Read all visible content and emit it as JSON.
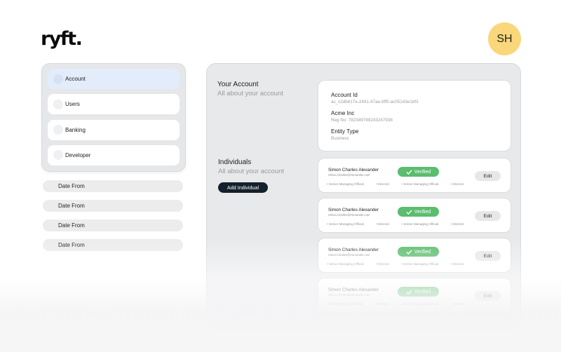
{
  "brand": {
    "logo_text": "ryft."
  },
  "user": {
    "initials": "SH"
  },
  "sidebar": {
    "items": [
      {
        "label": "Account",
        "active": true
      },
      {
        "label": "Users",
        "active": false
      },
      {
        "label": "Banking",
        "active": false
      },
      {
        "label": "Developer",
        "active": false
      }
    ]
  },
  "filters": [
    {
      "label": "Date From"
    },
    {
      "label": "Date From"
    },
    {
      "label": "Date From"
    },
    {
      "label": "Date From"
    }
  ],
  "account": {
    "title": "Your Account",
    "subtitle": "All about your account",
    "id_label": "Account Id",
    "id_value": "ac_c2db817e-2491-47ae-8ff5-ac05143e1bf3",
    "company_name": "Acme Inc",
    "reg_no": "Reg No: 782349789243247938",
    "entity_type_label": "Entity Type",
    "entity_type_value": "Business"
  },
  "individuals": {
    "title": "Individuals",
    "subtitle": "All about your account",
    "add_button": "Add Individual",
    "list": [
      {
        "name": "Simon Charles Alexander",
        "email": "Simon.Charles@Alexander.com",
        "status": "Verified",
        "edit": "Edit",
        "roles": [
          "Senior Managing Official",
          "Director",
          "Senior Managing Official",
          "Director"
        ]
      },
      {
        "name": "Simon Charles Alexander",
        "email": "Simon.Charles@Alexander.com",
        "status": "Verified",
        "edit": "Edit",
        "roles": [
          "Senior Managing Official",
          "Director",
          "Senior Managing Official",
          "Director"
        ]
      },
      {
        "name": "Simon Charles Alexander",
        "email": "Simon.Charles@Alexander.com",
        "status": "Verified",
        "edit": "Edit",
        "roles": [
          "Senior Managing Official",
          "Director",
          "Senior Managing Official",
          "Director"
        ]
      },
      {
        "name": "Simon Charles Alexander",
        "email": "Simon.Charles@Alexander.com",
        "status": "Verified",
        "edit": "Edit",
        "roles": [
          "Senior Managing Official",
          "Director",
          "Senior Managing Official",
          "Director"
        ]
      }
    ]
  },
  "colors": {
    "accent_dark": "#14202b",
    "verified_green": "#5bbd6e",
    "avatar_yellow": "#fad77a",
    "active_nav": "#e3ecfa"
  }
}
